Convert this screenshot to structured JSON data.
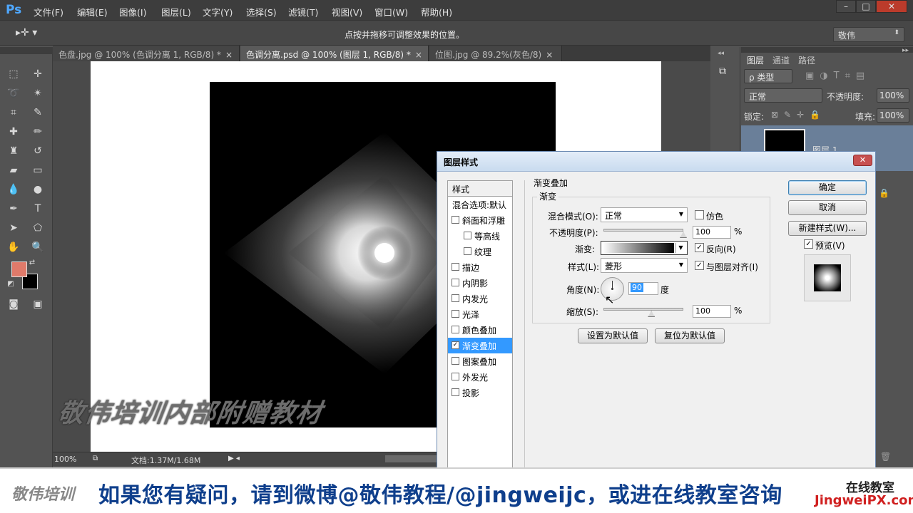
{
  "app": {
    "logo": "Ps"
  },
  "menu": [
    "文件(F)",
    "编辑(E)",
    "图像(I)",
    "图层(L)",
    "文字(Y)",
    "选择(S)",
    "滤镜(T)",
    "视图(V)",
    "窗口(W)",
    "帮助(H)"
  ],
  "window_controls": {
    "minimize": "–",
    "maximize": "□",
    "close": "✕"
  },
  "options_bar": {
    "tool_icon": "move-tool-icon",
    "hint": "点按并拖移可调整效果的位置。",
    "workspace": "敬伟"
  },
  "tabs": [
    {
      "label": "色盘.jpg @ 100% (色调分离 1, RGB/8) *",
      "close": "×"
    },
    {
      "label": "色调分离.psd @ 100% (图层 1, RGB/8) *",
      "close": "×"
    },
    {
      "label": "位图.jpg @ 89.2%(灰色/8)",
      "close": "×"
    }
  ],
  "canvas": {
    "watermark": "敬伟培训内部附赠教材",
    "gradient_style": "diamond",
    "gradient_reversed": true
  },
  "status_bar": {
    "zoom": "100%",
    "doc_info": "文档:1.37M/1.68M"
  },
  "colors": {
    "foreground": "#e07a6a",
    "background": "#000000",
    "accent": "#3399ff"
  },
  "layers_panel": {
    "tabs": [
      "图层",
      "通道",
      "路径"
    ],
    "filter": "ρ 类型",
    "blend_mode": "正常",
    "opacity_label": "不透明度:",
    "opacity_value": "100%",
    "lock_label": "锁定:",
    "fill_label": "填充:",
    "fill_value": "100%",
    "layer_name": "图层 1"
  },
  "dialog": {
    "title": "图层样式",
    "close": "✕",
    "styles_header": "样式",
    "styles": [
      {
        "label": "混合选项:默认",
        "checkbox": false,
        "checked": false,
        "sub": false,
        "selected": false
      },
      {
        "label": "斜面和浮雕",
        "checkbox": true,
        "checked": false,
        "sub": false,
        "selected": false
      },
      {
        "label": "等高线",
        "checkbox": true,
        "checked": false,
        "sub": true,
        "selected": false
      },
      {
        "label": "纹理",
        "checkbox": true,
        "checked": false,
        "sub": true,
        "selected": false
      },
      {
        "label": "描边",
        "checkbox": true,
        "checked": false,
        "sub": false,
        "selected": false
      },
      {
        "label": "内阴影",
        "checkbox": true,
        "checked": false,
        "sub": false,
        "selected": false
      },
      {
        "label": "内发光",
        "checkbox": true,
        "checked": false,
        "sub": false,
        "selected": false
      },
      {
        "label": "光泽",
        "checkbox": true,
        "checked": false,
        "sub": false,
        "selected": false
      },
      {
        "label": "颜色叠加",
        "checkbox": true,
        "checked": false,
        "sub": false,
        "selected": false
      },
      {
        "label": "渐变叠加",
        "checkbox": true,
        "checked": true,
        "sub": false,
        "selected": true
      },
      {
        "label": "图案叠加",
        "checkbox": true,
        "checked": false,
        "sub": false,
        "selected": false
      },
      {
        "label": "外发光",
        "checkbox": true,
        "checked": false,
        "sub": false,
        "selected": false
      },
      {
        "label": "投影",
        "checkbox": true,
        "checked": false,
        "sub": false,
        "selected": false
      }
    ],
    "section_title": "渐变叠加",
    "group_title": "渐变",
    "blend_mode_label": "混合模式(O):",
    "blend_mode_value": "正常",
    "dither_label": "仿色",
    "opacity_label": "不透明度(P):",
    "opacity_value": "100",
    "opacity_unit": "%",
    "gradient_label": "渐变:",
    "reverse_label": "反向(R)",
    "style_label": "样式(L):",
    "style_value": "菱形",
    "align_label": "与图层对齐(I)",
    "angle_label": "角度(N):",
    "angle_value": "90",
    "angle_unit": "度",
    "scale_label": "缩放(S):",
    "scale_value": "100",
    "scale_unit": "%",
    "opacity_level": 1.0,
    "scale_level": 0.6,
    "set_default": "设置为默认值",
    "reset_default": "复位为默认值",
    "ok": "确定",
    "cancel": "取消",
    "new_style": "新建样式(W)...",
    "preview_label": "预览(V)"
  },
  "banner": {
    "logo": "敬伟培训",
    "text": "如果您有疑问，请到微博@敬伟教程/@jingweijc，或进在线教室咨询",
    "site_line1": "在线教室",
    "site_line2": "JingweiPX.com"
  }
}
